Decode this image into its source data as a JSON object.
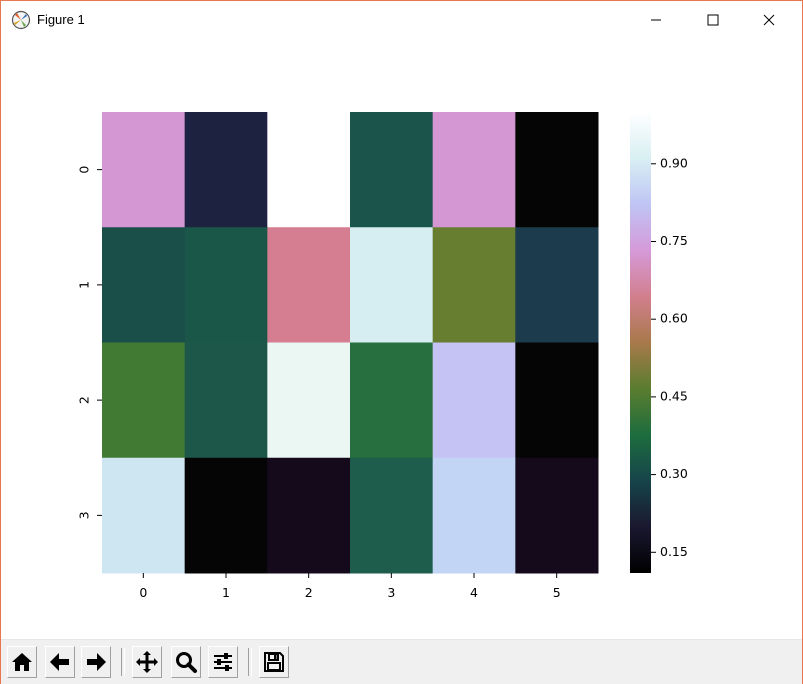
{
  "window": {
    "title": "Figure 1",
    "icons": {
      "app": "matplotlib-icon",
      "minimize": "minimize-icon",
      "maximize": "maximize-icon",
      "close": "close-icon"
    }
  },
  "toolbar": {
    "buttons": [
      {
        "name": "home-button",
        "icon": "home-icon"
      },
      {
        "name": "back-button",
        "icon": "arrow-left-icon"
      },
      {
        "name": "forward-button",
        "icon": "arrow-right-icon"
      },
      {
        "name": "pan-button",
        "icon": "move-icon"
      },
      {
        "name": "zoom-button",
        "icon": "magnifier-icon"
      },
      {
        "name": "configure-subplots-button",
        "icon": "sliders-icon"
      },
      {
        "name": "save-button",
        "icon": "floppy-disk-icon"
      }
    ],
    "status": ""
  },
  "chart_data": {
    "type": "heatmap",
    "colormap": "cubehelix",
    "x_ticklabels": [
      "0",
      "1",
      "2",
      "3",
      "4",
      "5"
    ],
    "y_ticklabels": [
      "0",
      "1",
      "2",
      "3"
    ],
    "values": [
      [
        0.79,
        0.22,
        1.0,
        0.31,
        0.79,
        0.11
      ],
      [
        0.3,
        0.32,
        0.67,
        0.93,
        0.49,
        0.26
      ],
      [
        0.42,
        0.33,
        0.97,
        0.39,
        0.82,
        0.11
      ],
      [
        0.92,
        0.11,
        0.15,
        0.33,
        0.86,
        0.15
      ]
    ],
    "colors": [
      [
        "#d497d3",
        "#1e2241",
        "#ffffff",
        "#1a544b",
        "#d497d3",
        "#050505"
      ],
      [
        "#1a4e49",
        "#1b5749",
        "#d57d91",
        "#d6edf2",
        "#677e31",
        "#1c3b4c"
      ],
      [
        "#417a33",
        "#1c5749",
        "#eaf7f2",
        "#276f3e",
        "#c5c3f3",
        "#050505"
      ],
      [
        "#cde6f2",
        "#050505",
        "#150a1c",
        "#1e5c4b",
        "#c2d5f4",
        "#150a1c"
      ]
    ],
    "colorbar": {
      "ticks": [
        0.15,
        0.3,
        0.45,
        0.6,
        0.75,
        0.9
      ],
      "tick_labels": [
        "0.15",
        "0.30",
        "0.45",
        "0.60",
        "0.75",
        "0.90"
      ],
      "range": [
        0.11,
        1.0
      ],
      "gradient_stops": [
        "#000000",
        "#1a1830",
        "#16444a",
        "#1d6d3e",
        "#5a7d2f",
        "#a8794a",
        "#d27f8e",
        "#d59ad9",
        "#bfc5f4",
        "#d8eff3",
        "#ffffff"
      ]
    },
    "title": "",
    "xlabel": "",
    "ylabel": ""
  }
}
